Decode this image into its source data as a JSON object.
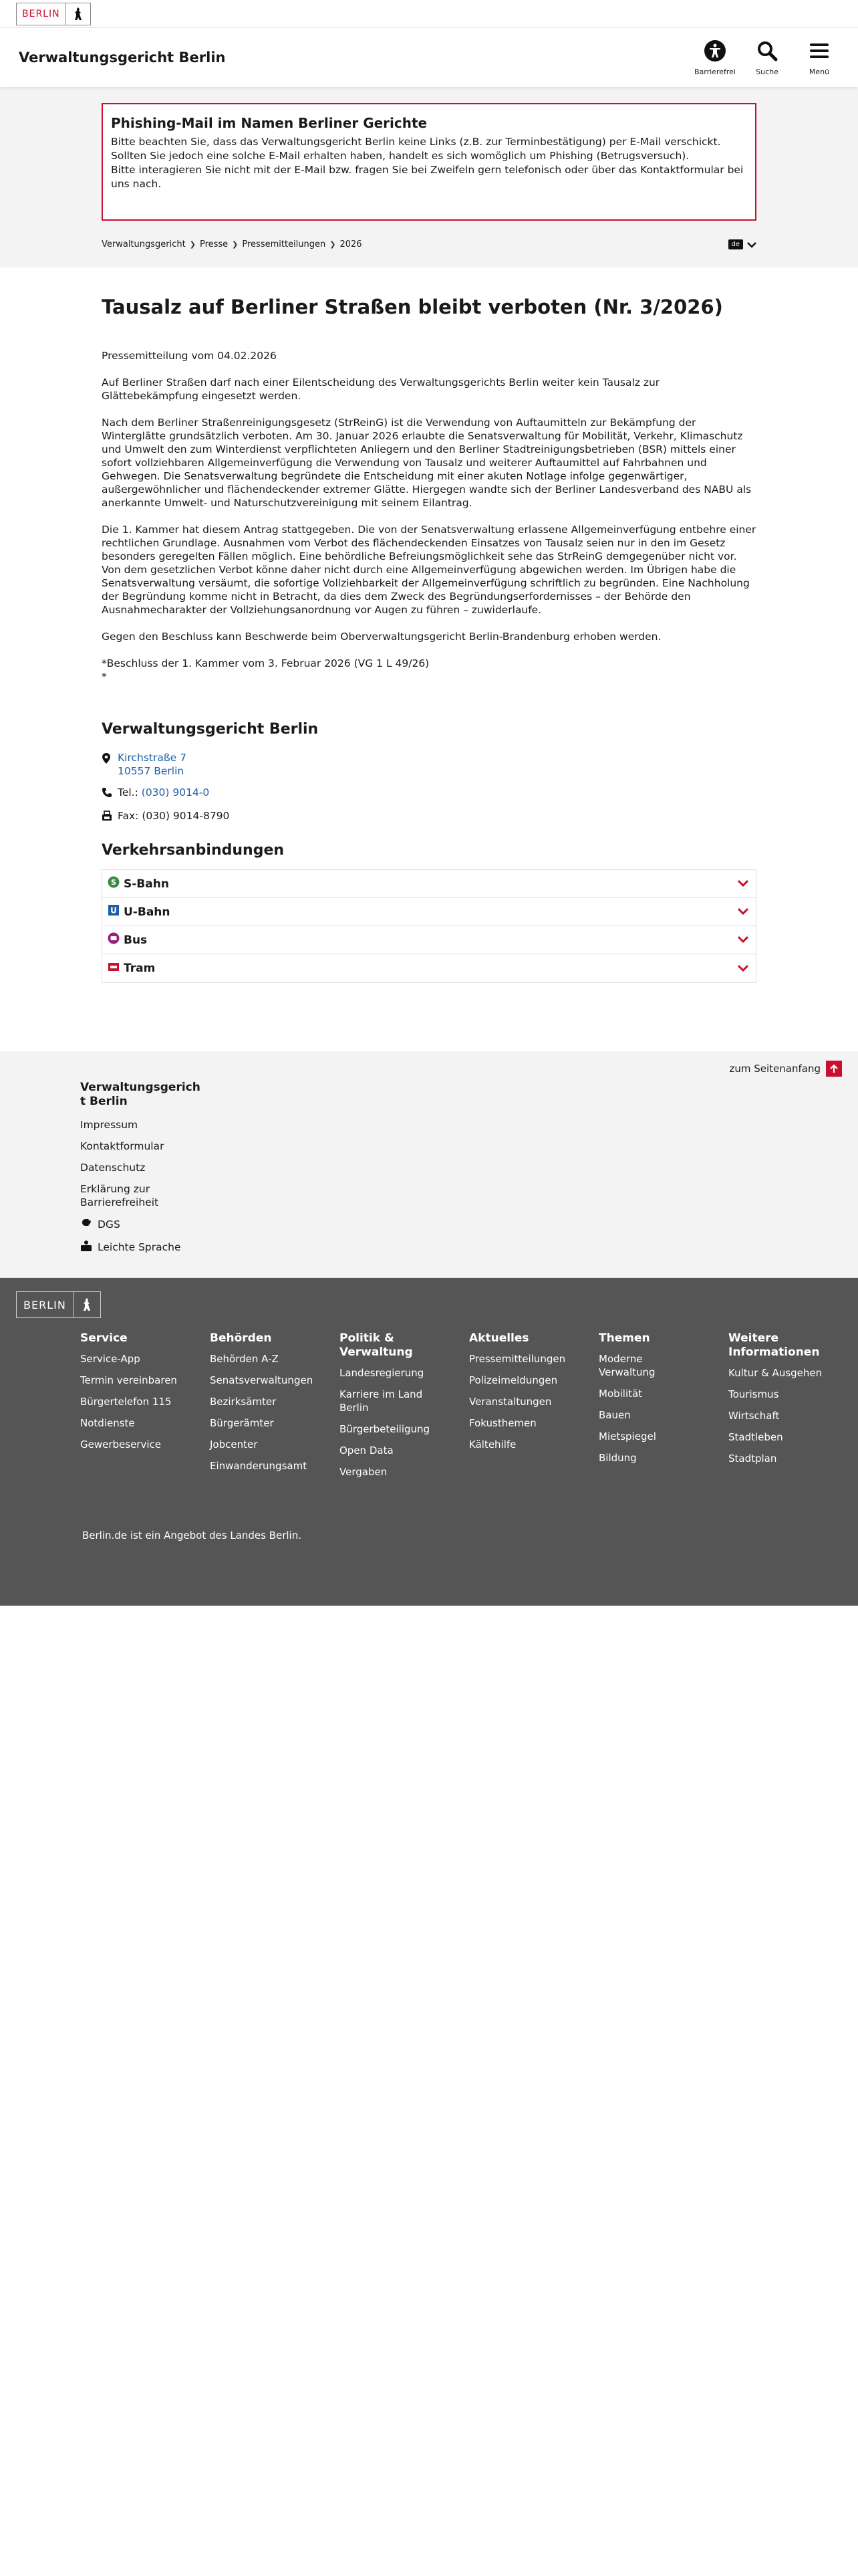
{
  "topbar": {
    "logo_text": "BERLIN"
  },
  "header": {
    "site_title": "Verwaltungsgericht Berlin",
    "tools": [
      {
        "label": "Barrierefrei",
        "icon": "accessibility-icon"
      },
      {
        "label": "Suche",
        "icon": "search-icon"
      },
      {
        "label": "Menü",
        "icon": "menu-icon"
      }
    ]
  },
  "alert": {
    "title": "Phishing-Mail im Namen Berliner Gerichte",
    "lines": [
      "Bitte beachten Sie, dass das Verwaltungsgericht Berlin keine Links (z.B. zur Terminbestätigung) per E-Mail verschickt.",
      "Sollten Sie jedoch eine solche E-Mail erhalten haben, handelt es sich womöglich um Phishing (Betrugsversuch).",
      "Bitte interagieren Sie nicht mit der E-Mail bzw. fragen Sie bei Zweifeln gern telefonisch oder über das Kontaktformular bei uns nach."
    ]
  },
  "breadcrumb": [
    "Verwaltungsgericht",
    "Presse",
    "Pressemitteilungen",
    "2026"
  ],
  "language": {
    "code": "de"
  },
  "article": {
    "title": "Tausalz auf Berliner Straßen bleibt verboten (Nr. 3/2026)",
    "date": "Pressemitteilung vom 04.02.2026",
    "paragraphs": [
      "Auf Berliner Straßen darf nach einer Eilentscheidung des Verwaltungsgerichts Berlin weiter kein Tausalz zur Glättebekämpfung eingesetzt werden.",
      "Nach dem Berliner Straßenreinigungsgesetz (StrReinG) ist die Verwendung von Auftaumitteln zur Bekämpfung der Winterglätte grundsätzlich verboten. Am 30. Januar 2026 erlaubte die Senatsverwaltung für Mobilität, Verkehr, Klimaschutz und Umwelt den zum Winterdienst verpflichteten Anliegern und den Berliner Stadtreinigungsbetrieben (BSR) mittels einer sofort vollziehbaren Allgemeinverfügung die Verwendung von Tausalz und weiterer Auftaumittel auf Fahrbahnen und Gehwegen. Die Senatsverwaltung begründete die Entscheidung mit einer akuten Notlage infolge gegenwärtiger, außergewöhnlicher und flächendeckender extremer Glätte. Hiergegen wandte sich der Berliner Landesverband des NABU als anerkannte Umwelt- und Naturschutzvereinigung mit seinem Eilantrag.",
      "Die 1. Kammer hat diesem Antrag stattgegeben. Die von der Senatsverwaltung erlassene Allgemeinverfügung entbehre einer rechtlichen Grundlage. Ausnahmen vom Verbot des flächendeckenden Einsatzes von Tausalz seien nur in den im Gesetz besonders geregelten Fällen möglich. Eine behördliche Befreiungsmöglichkeit sehe das StrReinG demgegenüber nicht vor. Von dem gesetzlichen Verbot könne daher nicht durch eine Allgemeinverfügung abgewichen werden. Im Übrigen habe die Senatsverwaltung versäumt, die sofortige Vollziehbarkeit der Allgemeinverfügung schriftlich zu begründen. Eine Nachholung der Begründung komme nicht in Betracht, da dies dem Zweck des Begründungserfordernisses – der Behörde den Ausnahmecharakter der Vollziehungsanordnung vor Augen zu führen – zuwiderlaufe.",
      "Gegen den Beschluss kann Beschwerde beim Oberverwaltungsgericht Berlin-Brandenburg erhoben werden."
    ],
    "footnote": "*Beschluss der 1. Kammer vom 3. Februar 2026 (VG 1 L 49/26)",
    "footnote_mark": "*"
  },
  "contact": {
    "heading": "Verwaltungsgericht Berlin",
    "street": "Kirchstraße 7",
    "city": "10557 Berlin",
    "tel_label": "Tel.:",
    "tel": "(030) 9014-0",
    "fax": "Fax: (030) 9014-8790"
  },
  "transport": {
    "heading": "Verkehrsanbindungen",
    "items": [
      {
        "label": "S-Bahn",
        "icon": "s-bahn-icon"
      },
      {
        "label": "U-Bahn",
        "icon": "u-bahn-icon"
      },
      {
        "label": "Bus",
        "icon": "bus-icon"
      },
      {
        "label": "Tram",
        "icon": "tram-icon"
      }
    ]
  },
  "footer_light": {
    "to_top": "zum Seitenanfang",
    "heading": "Verwaltungsgericht Berlin",
    "links": [
      "Impressum",
      "Kontaktformular",
      "Datenschutz",
      "Erklärung zur Barrierefreiheit"
    ],
    "dgs": "DGS",
    "leichte_sprache": "Leichte Sprache"
  },
  "footer_dark": {
    "logo_text": "BERLIN",
    "columns": [
      {
        "heading": "Service",
        "links": [
          "Service-App",
          "Termin vereinbaren",
          "Bürgertelefon 115",
          "Notdienste",
          "Gewerbeservice"
        ]
      },
      {
        "heading": "Behörden",
        "links": [
          "Behörden A-Z",
          "Senatsverwaltungen",
          "Bezirksämter",
          "Bürgerämter",
          "Jobcenter",
          "Einwanderungsamt"
        ]
      },
      {
        "heading": "Politik & Verwaltung",
        "links": [
          "Landesregierung",
          "Karriere im Land Berlin",
          "Bürgerbeteiligung",
          "Open Data",
          "Vergaben"
        ]
      },
      {
        "heading": "Aktuelles",
        "links": [
          "Pressemitteilungen",
          "Polizeimeldungen",
          "Veranstaltungen",
          "Fokusthemen",
          "Kältehilfe"
        ]
      },
      {
        "heading": "Themen",
        "links": [
          "Moderne Verwaltung",
          "Mobilität",
          "Bauen",
          "Mietspiegel",
          "Bildung"
        ]
      },
      {
        "heading": "Weitere Informationen",
        "links": [
          "Kultur & Ausgehen",
          "Tourismus",
          "Wirtschaft",
          "Stadtleben",
          "Stadtplan"
        ]
      }
    ],
    "bottom_text": "Berlin.de ist ein Angebot des Landes Berlin."
  }
}
